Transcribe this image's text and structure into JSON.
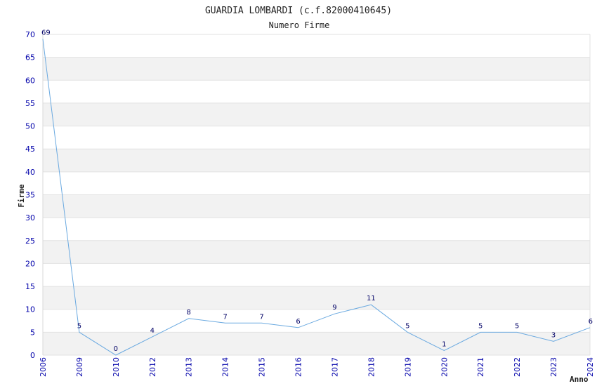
{
  "chart_data": {
    "type": "line",
    "title": "GUARDIA LOMBARDI (c.f.82000410645)",
    "subtitle": "Numero Firme",
    "xlabel": "Anno",
    "ylabel": "Firme",
    "categories": [
      "2006",
      "2009",
      "2010",
      "2012",
      "2013",
      "2014",
      "2015",
      "2016",
      "2017",
      "2018",
      "2019",
      "2020",
      "2021",
      "2022",
      "2023",
      "2024"
    ],
    "values": [
      69,
      5,
      0,
      4,
      8,
      7,
      7,
      6,
      9,
      11,
      5,
      1,
      5,
      5,
      3,
      6
    ],
    "ylim": [
      0,
      70
    ],
    "yticks": [
      0,
      5,
      10,
      15,
      20,
      25,
      30,
      35,
      40,
      45,
      50,
      55,
      60,
      65,
      70
    ],
    "grid": true,
    "line_color": "#6aa9e0",
    "band_color": "#f2f2f2",
    "tick_color": "#0000aa",
    "label_color": "#000066"
  }
}
